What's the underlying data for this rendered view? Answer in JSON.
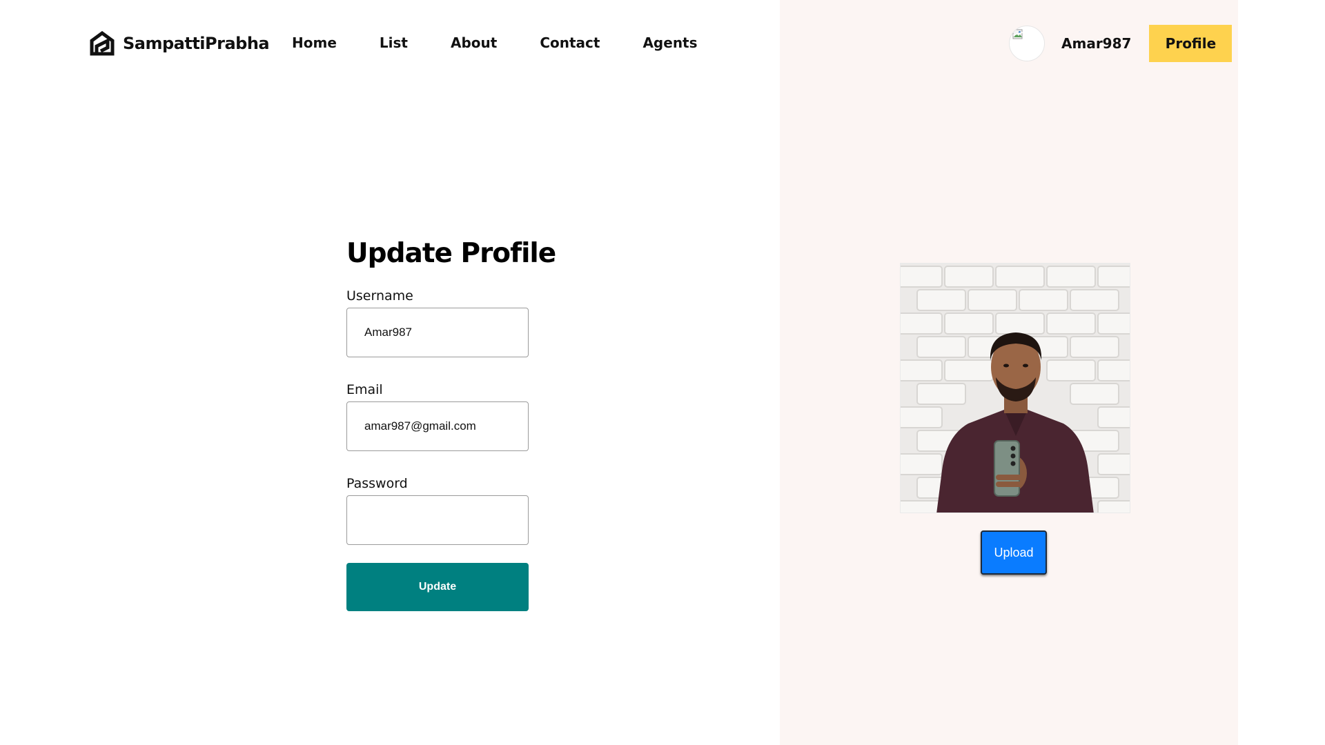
{
  "brand": {
    "name": "SampattiPrabha",
    "icon": "house-logo-icon"
  },
  "nav": {
    "links": [
      "Home",
      "List",
      "About",
      "Contact",
      "Agents"
    ]
  },
  "user": {
    "avatar_icon": "broken-image-icon",
    "username": "Amar987",
    "profile_label": "Profile"
  },
  "form": {
    "title": "Update Profile",
    "username_label": "Username",
    "username_value": "Amar987",
    "email_label": "Email",
    "email_value": "amar987@gmail.com",
    "password_label": "Password",
    "password_value": "",
    "submit_label": "Update"
  },
  "photo": {
    "upload_label": "Upload"
  },
  "colors": {
    "accent_yellow": "#fed24e",
    "update_teal": "#008080",
    "upload_blue": "#0a7cff",
    "panel_bg": "#fcf5f3"
  }
}
